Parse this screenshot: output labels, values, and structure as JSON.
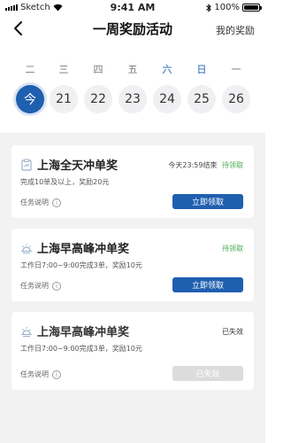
{
  "status_bar": {
    "carrier": "Sketch",
    "time": "9:41 AM",
    "battery_level": "100%"
  },
  "header": {
    "title": "一周奖励活动",
    "right_link": "我的奖励"
  },
  "week": [
    {
      "weekday": "二",
      "date": "今",
      "active": true,
      "weekend": false
    },
    {
      "weekday": "三",
      "date": "21",
      "active": false,
      "weekend": false
    },
    {
      "weekday": "四",
      "date": "22",
      "active": false,
      "weekend": false
    },
    {
      "weekday": "五",
      "date": "23",
      "active": false,
      "weekend": false
    },
    {
      "weekday": "六",
      "date": "24",
      "active": false,
      "weekend": true
    },
    {
      "weekday": "日",
      "date": "25",
      "active": false,
      "weekend": true
    },
    {
      "weekday": "一",
      "date": "26",
      "active": false,
      "weekend": false
    }
  ],
  "tasks": [
    {
      "title": "上海全天冲单奖",
      "icon": "clipboard-icon",
      "deadline": "今天23:59结束",
      "status": "待领取",
      "status_type": "pending",
      "description": "完成10单及以上，奖励20元",
      "info_label": "任务说明",
      "button_label": "立即领取",
      "button_enabled": true
    },
    {
      "title": "上海早高峰冲单奖",
      "icon": "sunrise-icon",
      "deadline": "",
      "status": "待领取",
      "status_type": "pending",
      "description": "工作日7:00~9:00完成3单，奖励10元",
      "info_label": "任务说明",
      "button_label": "立即领取",
      "button_enabled": true
    },
    {
      "title": "上海早高峰冲单奖",
      "icon": "sunrise-icon",
      "deadline": "",
      "status": "已失效",
      "status_type": "expired",
      "description": "工作日7:00~9:00完成3单，奖励10元",
      "info_label": "任务说明",
      "button_label": "已失效",
      "button_enabled": false
    }
  ],
  "colors": {
    "accent": "#1f5fb0",
    "pending": "#4aaa52",
    "disabled": "#dcdcdc",
    "background": "#f2f2f2"
  }
}
